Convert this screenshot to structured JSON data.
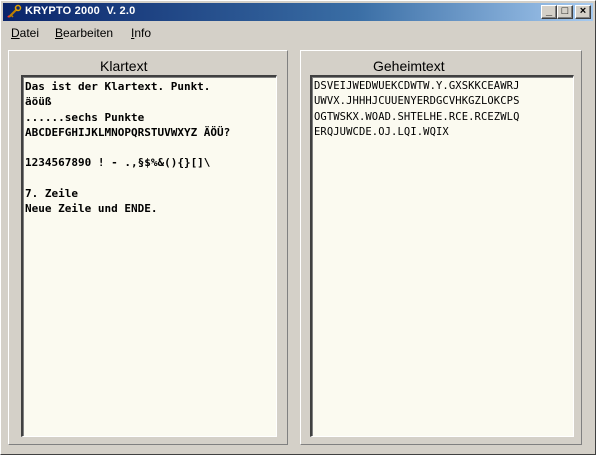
{
  "window": {
    "title": "KRYPTO 2000  V. 2.0",
    "buttons": {
      "minimize": "_",
      "maximize": "□",
      "close": "×"
    }
  },
  "menu": {
    "items": [
      {
        "first": "D",
        "rest": "atei"
      },
      {
        "first": "B",
        "rest": "earbeiten"
      },
      {
        "first": "I",
        "rest": "nfo"
      }
    ]
  },
  "klartext": {
    "title": "Klartext",
    "lines": [
      "Das ist der Klartext. Punkt.",
      "äöüß",
      "......sechs Punkte",
      "ABCDEFGHIJKLMNOPQRSTUVWXYZ ÄÖÜ?",
      "",
      "1234567890 ! - .,§$%&(){}[]\\",
      "",
      "7. Zeile",
      "Neue Zeile und ENDE."
    ]
  },
  "geheimtext": {
    "title": "Geheimtext",
    "lines": [
      "DSVEIJWEDWUEKCDWTW.Y.GXSKKCEAWRJ",
      "UWVX.JHHHJCUUENYERDGCVHKGZLOKCPS",
      "OGTWSKX.WOAD.SHTELHE.RCE.RCEZWLQ",
      "ERQJUWCDE.OJ.LQI.WQIX"
    ]
  },
  "colors": {
    "titlebar_start": "#0a246a",
    "titlebar_end": "#a6caf0",
    "memo_background": "#fbfaf0",
    "face": "#d4d0c8"
  },
  "icons": {
    "app": "key-icon"
  }
}
